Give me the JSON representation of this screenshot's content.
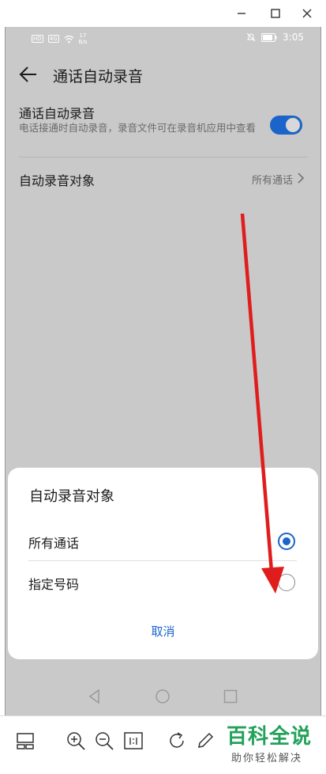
{
  "status_bar": {
    "hd_badge": "HD",
    "network": "4G",
    "speed_value": "17",
    "speed_unit": "B/s",
    "time": "3:05"
  },
  "app_bar": {
    "title": "通话自动录音"
  },
  "settings": {
    "auto_record": {
      "title": "通话自动录音",
      "description": "电话接通时自动录音，录音文件可在录音机应用中查看",
      "enabled": true
    },
    "record_target": {
      "title": "自动录音对象",
      "value": "所有通话"
    }
  },
  "dialog": {
    "title": "自动录音对象",
    "options": [
      {
        "label": "所有通话",
        "selected": true
      },
      {
        "label": "指定号码",
        "selected": false
      }
    ],
    "cancel_label": "取消"
  },
  "watermark": {
    "main": "百科全说",
    "sub": "助你轻松解决"
  },
  "colors": {
    "accent": "#1b64c9",
    "overlay": "#c9c9c9",
    "annotation": "#e01d1d",
    "watermark": "#23a15a"
  }
}
